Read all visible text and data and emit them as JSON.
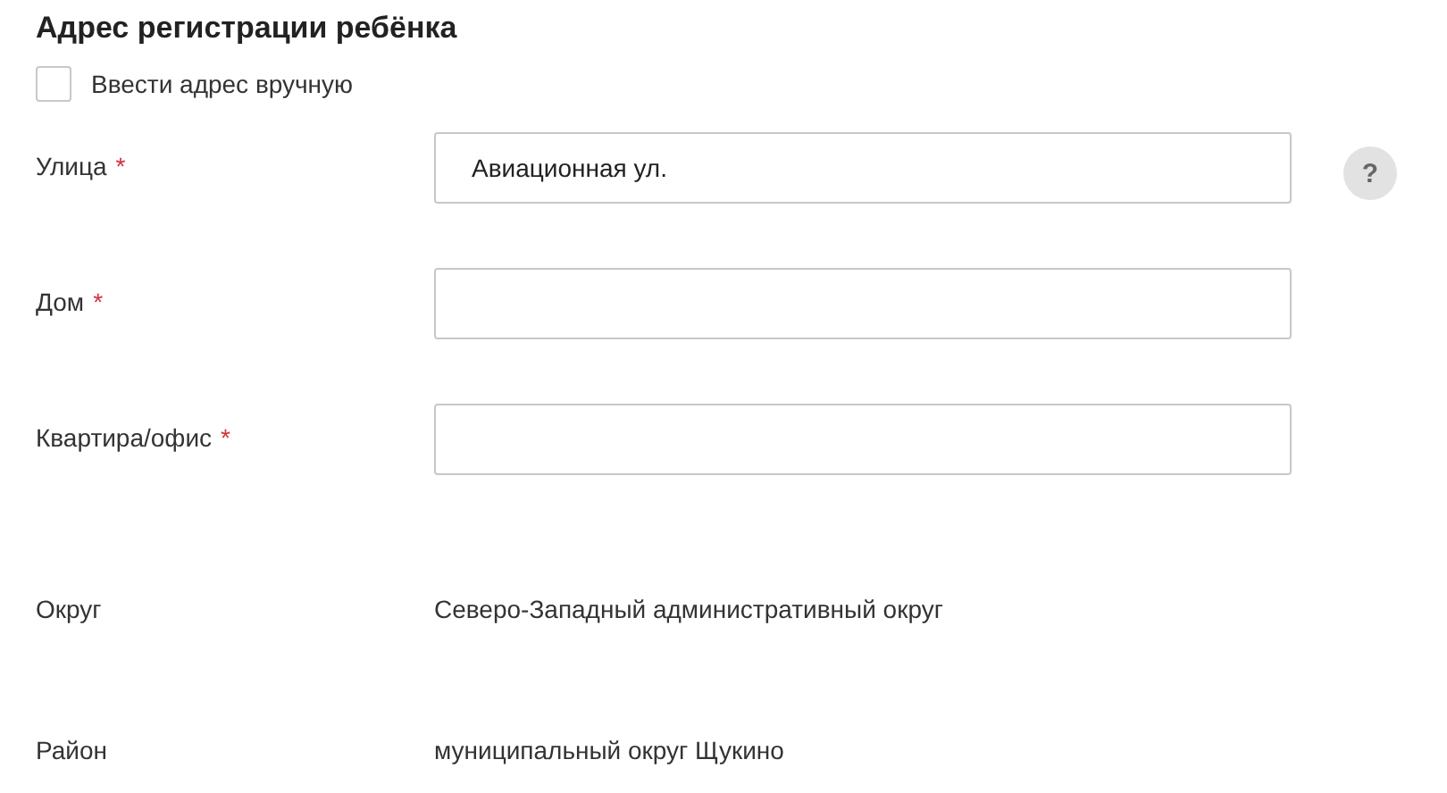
{
  "title": "Адрес регистрации ребёнка",
  "manual_entry": {
    "label": "Ввести адрес вручную",
    "checked": false
  },
  "fields": [
    {
      "label": "Улица",
      "required_mark": "*",
      "value": "Авиационная ул.",
      "help": "?"
    },
    {
      "label": "Дом",
      "required_mark": "*"
    },
    {
      "label": "Квартира/офис",
      "required_mark": "*"
    }
  ],
  "info": [
    {
      "label": "Округ",
      "value": "Северо-Западный административный округ"
    },
    {
      "label": "Район",
      "value": "муниципальный округ Щукино"
    }
  ]
}
